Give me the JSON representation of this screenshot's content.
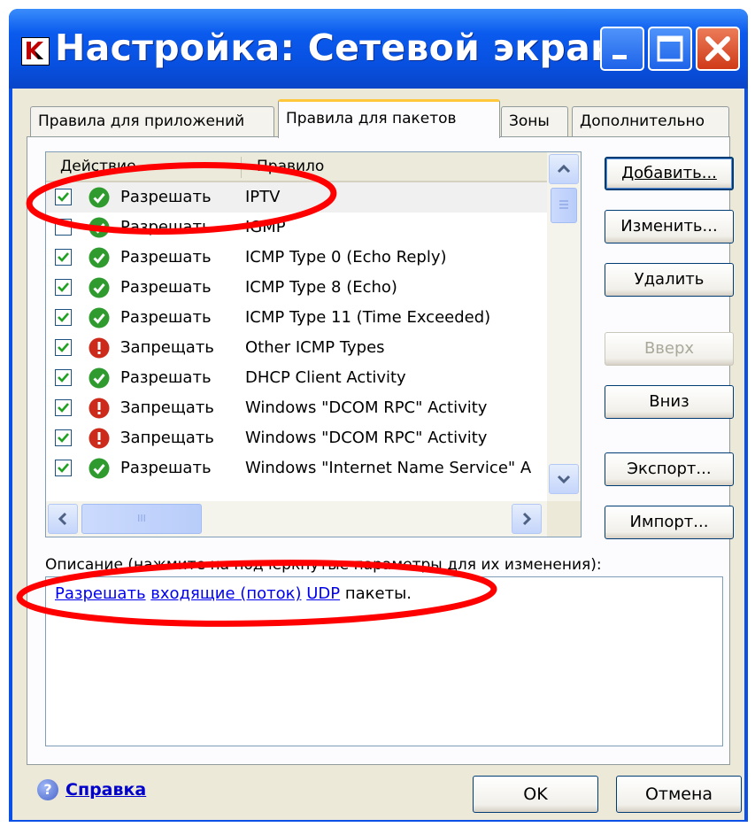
{
  "window": {
    "title": "Настройка: Сетевой экран"
  },
  "tabs": [
    {
      "label": "Правила для приложений"
    },
    {
      "label": "Правила для пакетов"
    },
    {
      "label": "Зоны"
    },
    {
      "label": "Дополнительно"
    }
  ],
  "list": {
    "columns": {
      "action": "Действие",
      "rule": "Правило"
    },
    "rows": [
      {
        "checked": true,
        "status": "allow",
        "action": "Разрешать",
        "rule": "IPTV"
      },
      {
        "checked": false,
        "status": "allow",
        "action": "Разрешать",
        "rule": "IGMP"
      },
      {
        "checked": true,
        "status": "allow",
        "action": "Разрешать",
        "rule": "ICMP Type 0 (Echo Reply)"
      },
      {
        "checked": true,
        "status": "allow",
        "action": "Разрешать",
        "rule": "ICMP Type 8 (Echo)"
      },
      {
        "checked": true,
        "status": "allow",
        "action": "Разрешать",
        "rule": "ICMP Type 11 (Time Exceeded)"
      },
      {
        "checked": true,
        "status": "deny",
        "action": "Запрещать",
        "rule": "Other ICMP Types"
      },
      {
        "checked": true,
        "status": "allow",
        "action": "Разрешать",
        "rule": "DHCP Client Activity"
      },
      {
        "checked": true,
        "status": "deny",
        "action": "Запрещать",
        "rule": "Windows \"DCOM RPC\" Activity"
      },
      {
        "checked": true,
        "status": "deny",
        "action": "Запрещать",
        "rule": "Windows \"DCOM RPC\" Activity"
      },
      {
        "checked": true,
        "status": "allow",
        "action": "Разрешать",
        "rule": "Windows \"Internet Name Service\" A"
      }
    ],
    "hscroll_glyph": "III"
  },
  "buttons": {
    "add": "Добавить...",
    "edit": "Изменить...",
    "delete": "Удалить",
    "up": "Вверх",
    "down": "Вниз",
    "export": "Экспорт...",
    "import": "Импорт..."
  },
  "description": {
    "label": "Описание (нажмите на подчеркнутые параметры для их изменения):",
    "parts": [
      {
        "text": "Разрешать",
        "link": true
      },
      {
        "text": " ",
        "link": false
      },
      {
        "text": "входящие (поток)",
        "link": true
      },
      {
        "text": " ",
        "link": false
      },
      {
        "text": "UDP",
        "link": true
      },
      {
        "text": " пакеты.",
        "link": false
      }
    ]
  },
  "footer": {
    "help": "Справка",
    "ok": "OK",
    "cancel": "Отмена"
  },
  "colors": {
    "titlebar": "#0b5bee",
    "allow_icon": "#2f9b2f",
    "deny_icon": "#cc2a1a",
    "annotation": "#ff0000",
    "link": "#0000ee"
  },
  "icons": {
    "allow": "check-circle-icon",
    "deny": "exclamation-circle-icon",
    "app": "kaspersky-k-icon"
  }
}
